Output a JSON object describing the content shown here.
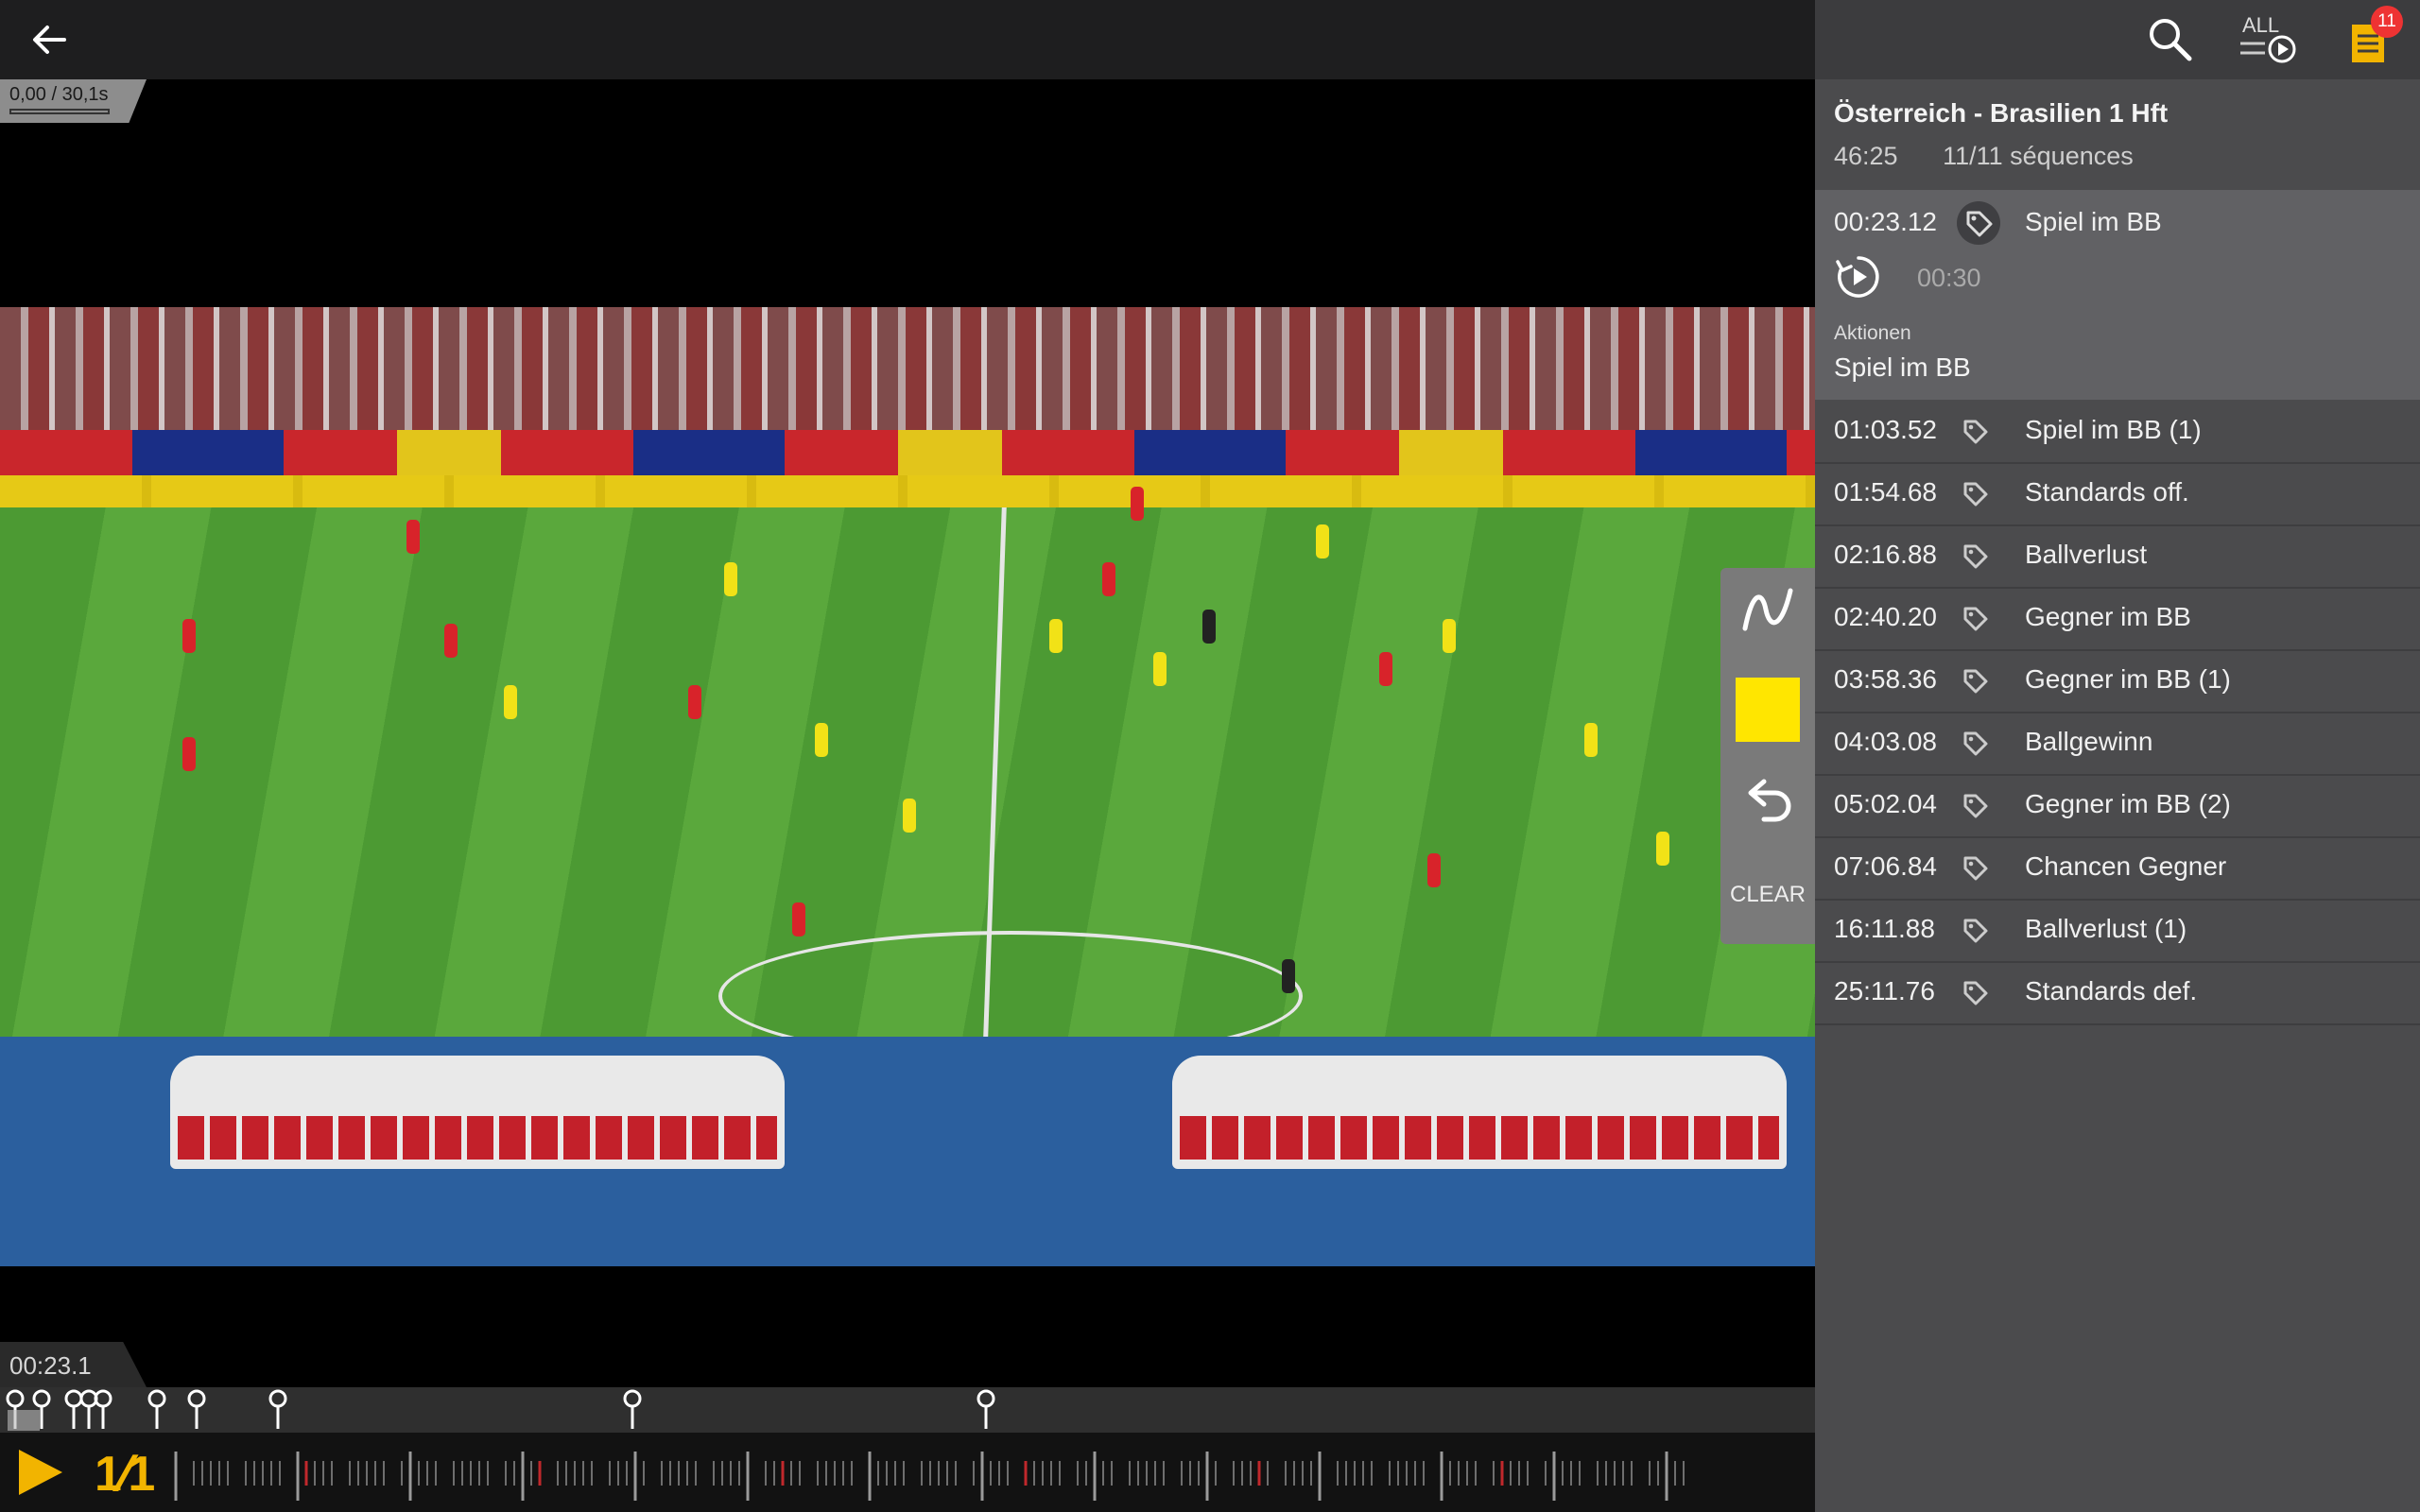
{
  "player": {
    "clip_counter": "0,00 / 30,1s",
    "current_time": "00:23.1",
    "drawing_color": "#ffe600",
    "clear_label": "CLEAR"
  },
  "icons": {
    "back": "arrow-left-icon",
    "draw": "freehand-draw-icon",
    "undo": "undo-icon",
    "play": "play-icon",
    "search": "search-icon",
    "all_play": "play-all-icon",
    "list": "playlist-icon",
    "tag": "tag-icon"
  },
  "playback": {
    "speed_label": "1/1",
    "speed_num": "1",
    "speed_den": "1",
    "accent_color": "#f2b400"
  },
  "panel": {
    "all_label": "ALL",
    "badge_count": "11",
    "match_title": "Österreich - Brasilien 1 Hft",
    "duration": "46:25",
    "sequence_count": "11/11 séquences",
    "selected": {
      "time": "00:23.12",
      "label": "Spiel im BB",
      "duration": "00:30",
      "category_caption": "Aktionen",
      "category_value": "Spiel im BB"
    },
    "sequences": [
      {
        "time": "01:03.52",
        "label": "Spiel im BB (1)"
      },
      {
        "time": "01:54.68",
        "label": "Standards off."
      },
      {
        "time": "02:16.88",
        "label": "Ballverlust"
      },
      {
        "time": "02:40.20",
        "label": "Gegner im BB"
      },
      {
        "time": "03:58.36",
        "label": "Gegner im BB (1)"
      },
      {
        "time": "04:03.08",
        "label": "Ballgewinn"
      },
      {
        "time": "05:02.04",
        "label": "Gegner im BB (2)"
      },
      {
        "time": "07:06.84",
        "label": "Chancen Gegner"
      },
      {
        "time": "16:11.88",
        "label": "Ballverlust (1)"
      },
      {
        "time": "25:11.76",
        "label": "Standards def."
      }
    ]
  }
}
